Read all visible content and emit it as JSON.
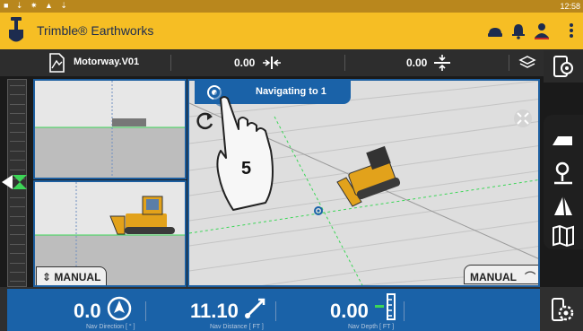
{
  "status_bar": {
    "icons": "■ ⇣ ✷ ▲ ⇣",
    "time": "12:58"
  },
  "app": {
    "title": "Trimble® Earthworks"
  },
  "info_bar": {
    "design_name": "Motorway.V01",
    "cut_fill_value": "0.00",
    "vertical_offset_value": "0.00"
  },
  "views": {
    "profile": {
      "mode_label": "MANUAL"
    },
    "plan": {
      "mode_label": "MANUAL",
      "banner": "Navigating to 1",
      "tutorial_step": "5"
    }
  },
  "bottom_bar": {
    "items": [
      {
        "value": "0.0",
        "label": "Nav Direction [ ° ]",
        "icon": "compass-icon"
      },
      {
        "value": "11.10",
        "label": "Nav Distance [ FT ]",
        "icon": "distance-icon"
      },
      {
        "value": "0.00",
        "label": "Nav Depth [ FT ]",
        "icon": "depth-icon"
      }
    ]
  },
  "colors": {
    "brand": "#f6be24",
    "accent": "#1a62a8",
    "design_line": "#3cd657"
  }
}
